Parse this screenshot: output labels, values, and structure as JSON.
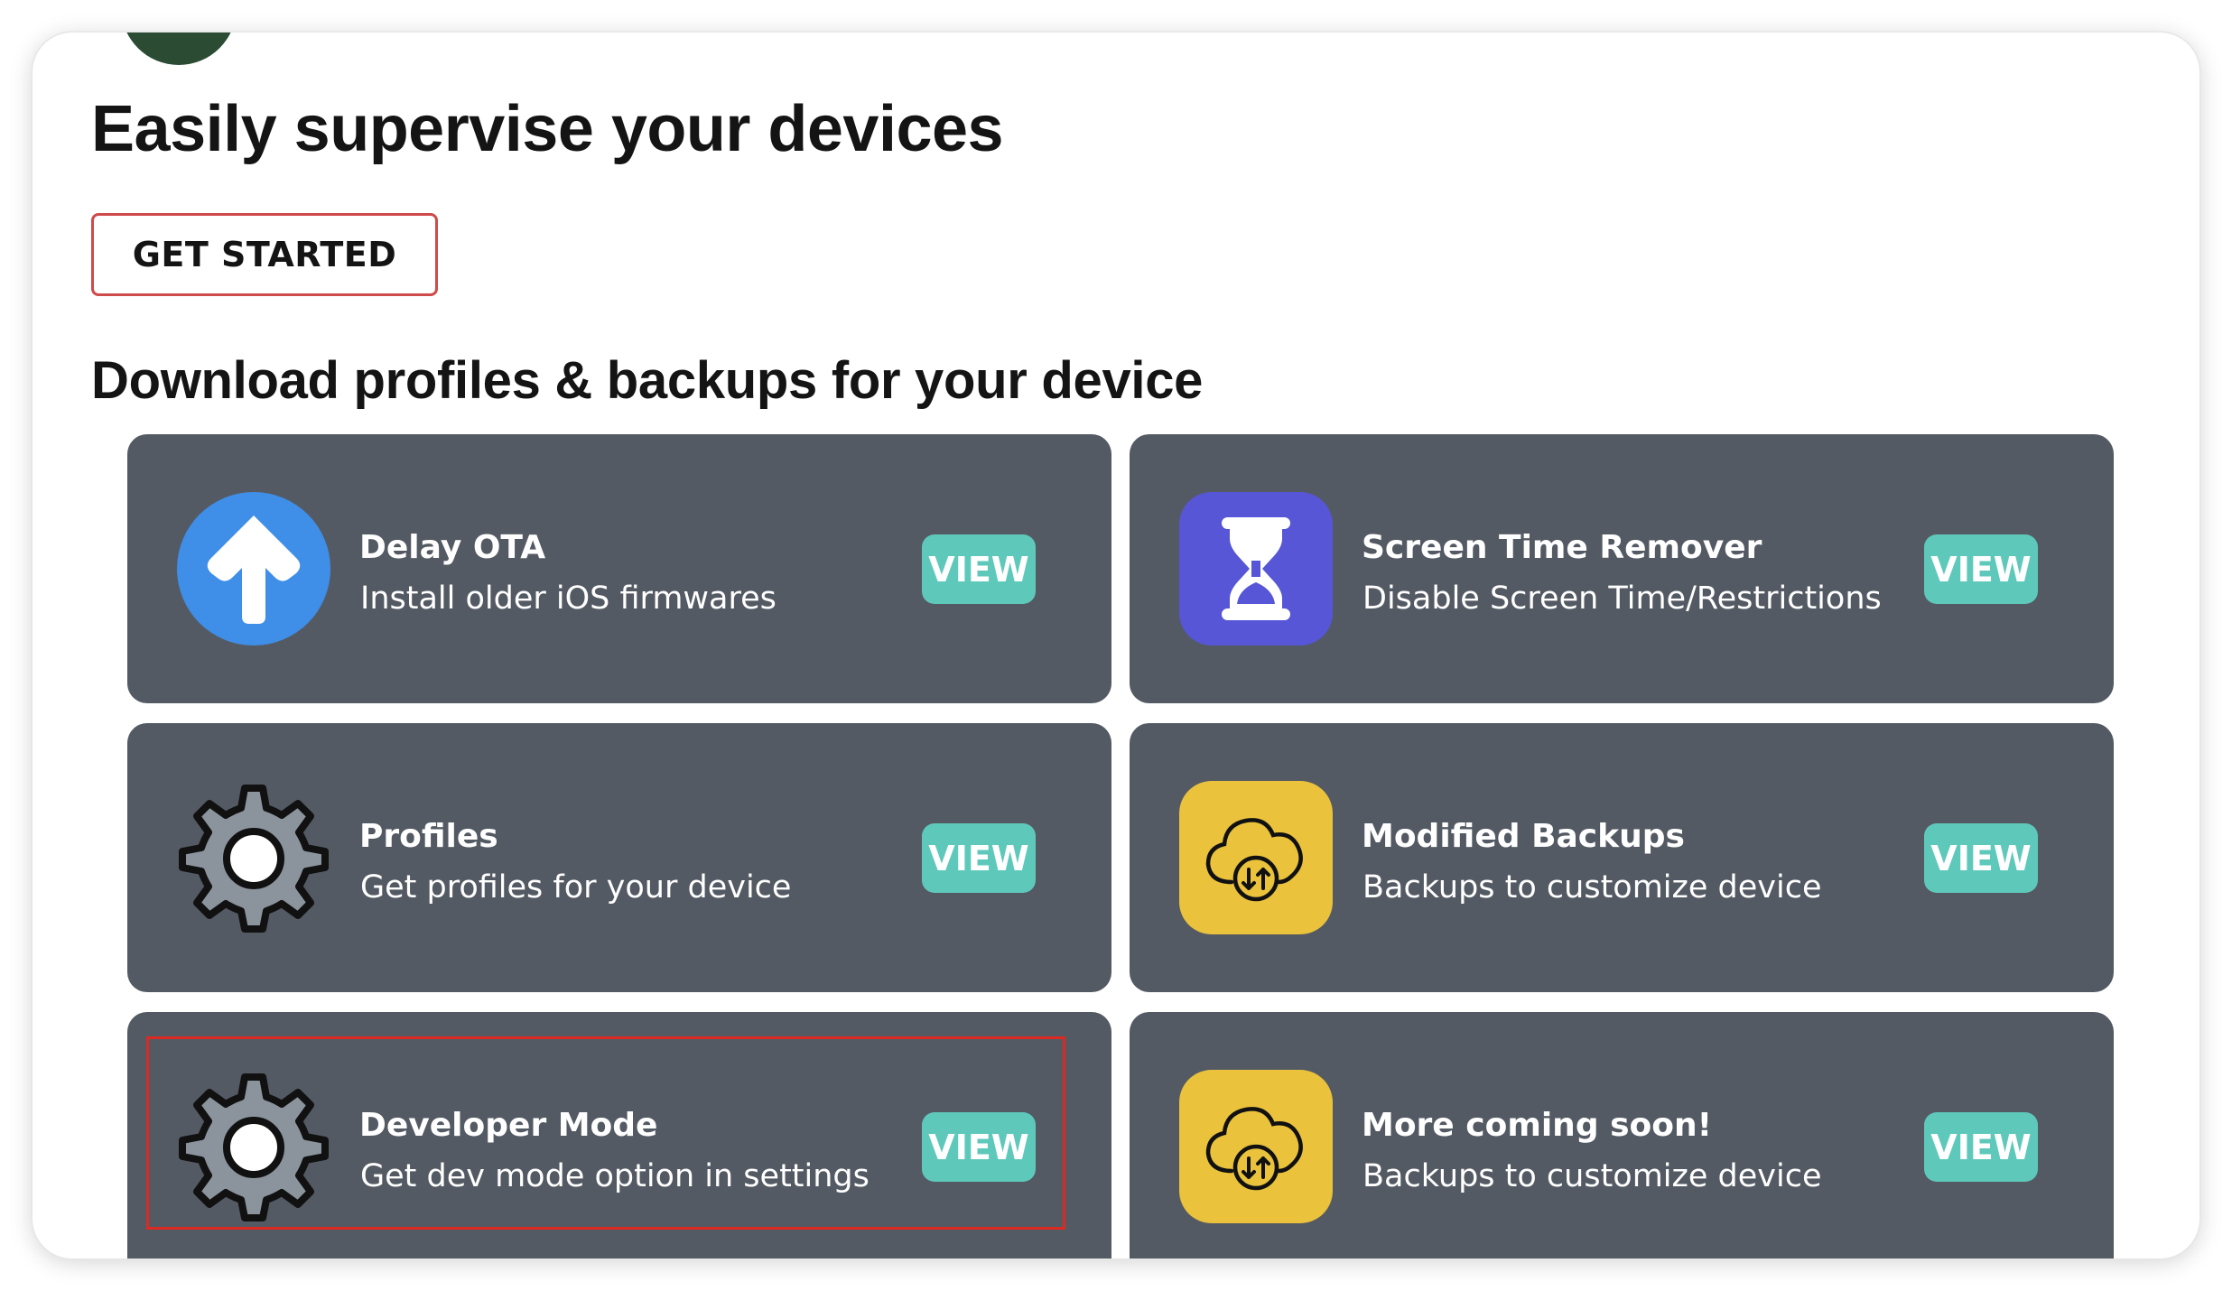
{
  "hero": {
    "title": "Easily supervise your devices",
    "cta_label": "GET STARTED"
  },
  "section": {
    "title": "Download profiles & backups for your device"
  },
  "cards": [
    {
      "title": "Delay OTA",
      "subtitle": "Install older iOS firmwares",
      "button": "VIEW",
      "icon": "arrow-up-icon"
    },
    {
      "title": "Screen Time Remover",
      "subtitle": "Disable Screen Time/Restrictions",
      "button": "VIEW",
      "icon": "hourglass-icon"
    },
    {
      "title": "Profiles",
      "subtitle": "Get profiles for your device",
      "button": "VIEW",
      "icon": "gear-icon"
    },
    {
      "title": "Modified Backups",
      "subtitle": "Backups to customize device",
      "button": "VIEW",
      "icon": "cloud-sync-icon"
    },
    {
      "title": "Developer Mode",
      "subtitle": "Get dev mode option in settings",
      "button": "VIEW",
      "icon": "gear-icon"
    },
    {
      "title": "More coming soon!",
      "subtitle": "Backups to customize device",
      "button": "VIEW",
      "icon": "cloud-sync-icon"
    }
  ],
  "colors": {
    "card_background": "#545a63",
    "view_button": "#5ec9bb",
    "cta_border": "#cf4a4a",
    "highlight": "#dc2a22",
    "arrow_icon_bg": "#3f8ee8",
    "hourglass_icon_bg": "#5656d6",
    "cloud_icon_bg": "#eac23c"
  }
}
